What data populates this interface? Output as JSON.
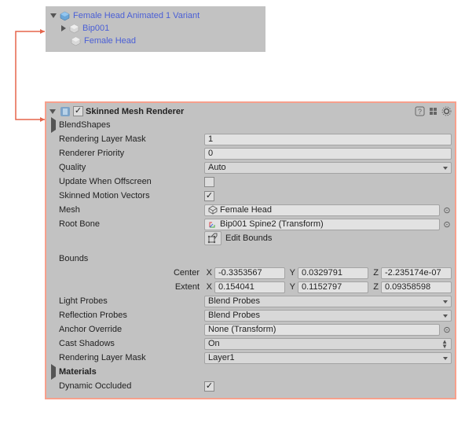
{
  "hierarchy": {
    "root": "Female Head Animated 1 Variant",
    "child1": "Bip001",
    "child2": "Female Head"
  },
  "component": {
    "title": "Skinned Mesh Renderer",
    "blendshapes": "BlendShapes",
    "renderingLayerMaskLabel": "Rendering Layer Mask",
    "renderingLayerMaskValue": "1",
    "rendererPriorityLabel": "Renderer Priority",
    "rendererPriorityValue": "0",
    "qualityLabel": "Quality",
    "qualityValue": "Auto",
    "updateWhenOffscreenLabel": "Update When Offscreen",
    "skinnedMotionVectorsLabel": "Skinned Motion Vectors",
    "meshLabel": "Mesh",
    "meshValue": "Female Head",
    "rootBoneLabel": "Root Bone",
    "rootBoneValue": "Bip001 Spine2 (Transform)",
    "editBounds": "Edit Bounds",
    "boundsLabel": "Bounds",
    "centerLabel": "Center",
    "extentLabel": "Extent",
    "center": {
      "x": "-0.3353567",
      "y": "0.0329791",
      "z": "-2.235174e-07"
    },
    "extent": {
      "x": "0.154041",
      "y": "0.1152797",
      "z": "0.09358598"
    },
    "lightProbesLabel": "Light Probes",
    "lightProbesValue": "Blend Probes",
    "reflectionProbesLabel": "Reflection Probes",
    "reflectionProbesValue": "Blend Probes",
    "anchorOverrideLabel": "Anchor Override",
    "anchorOverrideValue": "None (Transform)",
    "castShadowsLabel": "Cast Shadows",
    "castShadowsValue": "On",
    "renderingLayerMask2Label": "Rendering Layer Mask",
    "renderingLayerMask2Value": "Layer1",
    "materialsLabel": "Materials",
    "dynamicOccludedLabel": "Dynamic Occluded"
  },
  "axes": {
    "x": "X",
    "y": "Y",
    "z": "Z"
  }
}
